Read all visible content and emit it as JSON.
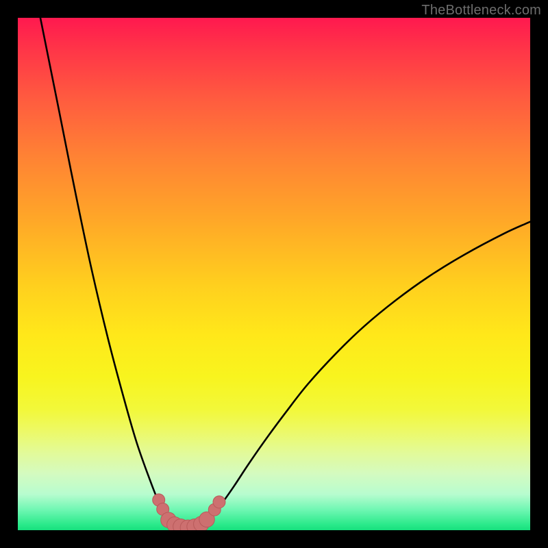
{
  "watermark": "TheBottleneck.com",
  "colors": {
    "frame": "#000000",
    "curve": "#000000",
    "marker_fill": "#cd7070",
    "marker_stroke": "#b85a5a"
  },
  "chart_data": {
    "type": "line",
    "title": "",
    "xlabel": "",
    "ylabel": "",
    "xlim": [
      0,
      100
    ],
    "ylim": [
      0,
      100
    ],
    "note": "Axes are unlabeled in the source image; x treated as 0–100 across plot width, y as 0–100 bottleneck severity (0 = green/good at bottom, 100 = red/bad at top). Values estimated from pixel positions.",
    "series": [
      {
        "name": "left-branch",
        "x": [
          4.4,
          8.0,
          11.4,
          14.4,
          17.6,
          20.6,
          23.2,
          25.9,
          27.5,
          28.6,
          30.1,
          32.1
        ],
        "y": [
          100.0,
          82.1,
          65.1,
          50.9,
          37.4,
          26.1,
          17.1,
          9.5,
          5.5,
          3.6,
          1.7,
          0.5
        ]
      },
      {
        "name": "right-branch",
        "x": [
          34.8,
          36.6,
          38.2,
          39.8,
          42.2,
          44.9,
          48.3,
          52.3,
          56.6,
          62.2,
          67.6,
          73.8,
          80.2,
          87.2,
          94.9,
          100.0
        ],
        "y": [
          0.5,
          1.7,
          3.3,
          5.2,
          8.6,
          12.7,
          17.6,
          23.0,
          28.5,
          34.6,
          39.8,
          44.9,
          49.5,
          53.8,
          57.9,
          60.2
        ]
      }
    ],
    "markers": {
      "note": "Pink bead-like markers shown near the valley floor on both branches.",
      "points": [
        {
          "x": 27.5,
          "y": 5.9,
          "r": 1.2
        },
        {
          "x": 28.3,
          "y": 4.1,
          "r": 1.2
        },
        {
          "x": 29.4,
          "y": 2.0,
          "r": 1.5
        },
        {
          "x": 30.6,
          "y": 1.1,
          "r": 1.5
        },
        {
          "x": 31.8,
          "y": 0.7,
          "r": 1.5
        },
        {
          "x": 33.2,
          "y": 0.5,
          "r": 1.5
        },
        {
          "x": 34.5,
          "y": 0.7,
          "r": 1.5
        },
        {
          "x": 35.8,
          "y": 1.2,
          "r": 1.5
        },
        {
          "x": 36.9,
          "y": 2.1,
          "r": 1.5
        },
        {
          "x": 38.4,
          "y": 4.0,
          "r": 1.2
        },
        {
          "x": 39.3,
          "y": 5.5,
          "r": 1.2
        }
      ]
    }
  }
}
